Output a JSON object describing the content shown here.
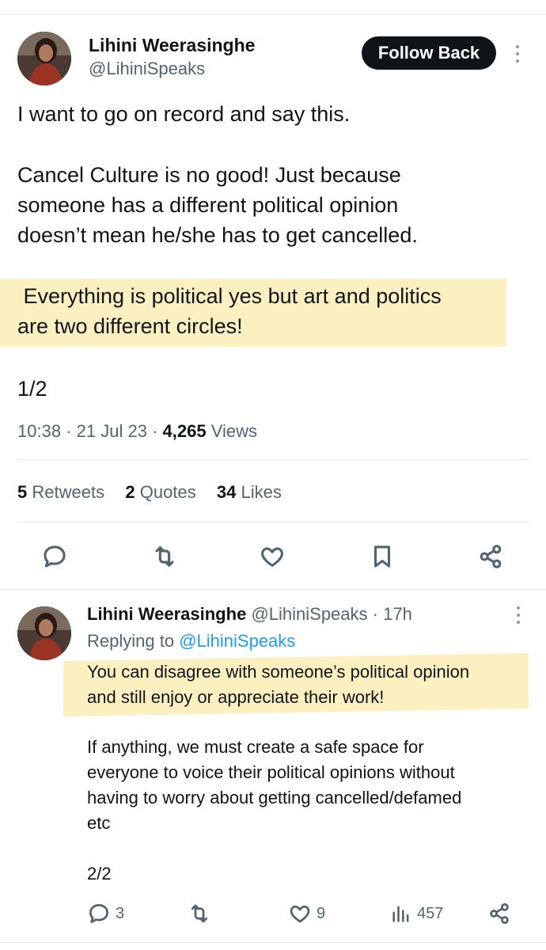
{
  "main_tweet": {
    "author_name": "Lihini Weerasinghe",
    "author_handle": "@LihiniSpeaks",
    "follow_label": "Follow Back",
    "lines": [
      "I want to go on record and say this.",
      "Cancel Culture is no good! Just because",
      "someone has a different political opinion",
      "doesn’t mean he/she has to get cancelled.",
      " Everything is political yes but art and politics",
      "are two different circles!",
      "1/2"
    ],
    "time": "10:38",
    "date": "21 Jul 23",
    "views_count": "4,265",
    "views_label": "Views",
    "retweets_count": "5",
    "retweets_label": "Retweets",
    "quotes_count": "2",
    "quotes_label": "Quotes",
    "likes_count": "34",
    "likes_label": "Likes"
  },
  "reply_tweet": {
    "author_name": "Lihini Weerasinghe",
    "author_handle": "@LihiniSpeaks",
    "age": "17h",
    "replying_to_label": "Replying to",
    "replying_to_handle": "@LihiniSpeaks",
    "lines": [
      "You can disagree with someone’s political opinion",
      "and still enjoy or appreciate their work!",
      "If anything, we must create a safe space for",
      "everyone to voice their political opinions without",
      "having to worry about getting cancelled/defamed",
      "etc",
      "2/2"
    ],
    "replies_count": "3",
    "likes_count": "9",
    "views_count": "457"
  },
  "colors": {
    "highlight": "#fcefc0",
    "link": "#1d9bf0",
    "muted": "#536471",
    "follow_bg": "#0f1419"
  }
}
